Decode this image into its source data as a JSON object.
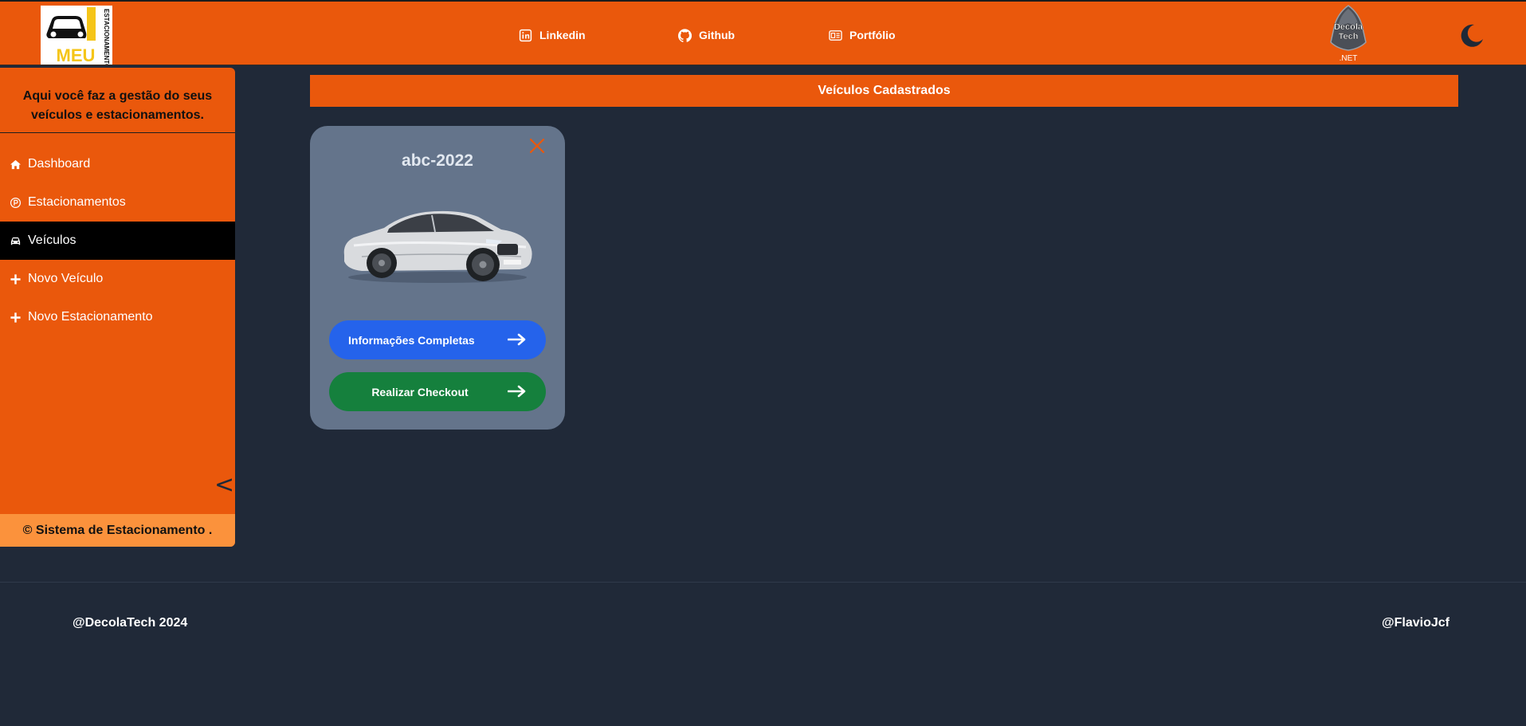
{
  "header": {
    "logo_text": "MEU",
    "logo_vertical_text": "ESTACIONAMENTO",
    "nav": [
      {
        "label": "Linkedin",
        "icon": "linkedin-icon"
      },
      {
        "label": "Github",
        "icon": "github-icon"
      },
      {
        "label": "Portfólio",
        "icon": "portfolio-icon"
      }
    ],
    "partner_logo_text_top": "Decola",
    "partner_logo_text_bottom": "Tech",
    "partner_logo_caption": ".NET",
    "theme_toggle_icon": "moon-icon"
  },
  "sidebar": {
    "intro": "Aqui você faz a gestão do seus veículos e estacionamentos.",
    "items": [
      {
        "label": "Dashboard",
        "icon": "home-icon",
        "active": false
      },
      {
        "label": "Estacionamentos",
        "icon": "parking-icon",
        "active": false
      },
      {
        "label": "Veículos",
        "icon": "car-icon",
        "active": true
      },
      {
        "label": "Novo Veículo",
        "icon": "plus-icon",
        "active": false
      },
      {
        "label": "Novo Estacionamento",
        "icon": "plus-icon",
        "active": false
      }
    ],
    "collapse_glyph": "<",
    "footer": "© Sistema de Estacionamento ."
  },
  "main": {
    "section_title": "Veículos Cadastrados",
    "vehicles": [
      {
        "plate": "abc-2022",
        "info_button": "Informações Completas",
        "checkout_button": "Realizar Checkout"
      }
    ]
  },
  "footer": {
    "left": "@DecolaTech 2024",
    "right": "@FlavioJcf"
  },
  "colors": {
    "brand_orange": "#ea580c",
    "background": "#202938",
    "card": "#64748b",
    "info_blue": "#2563eb",
    "checkout_green": "#15803d"
  }
}
